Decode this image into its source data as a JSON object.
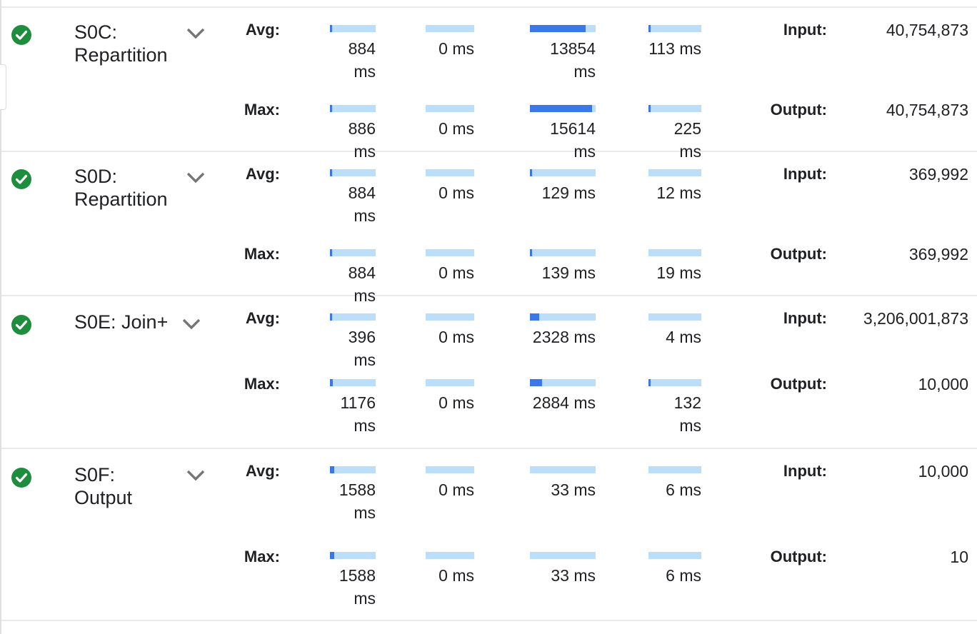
{
  "labels": {
    "avg": "Avg:",
    "max": "Max:",
    "input": "Input:",
    "output": "Output:"
  },
  "colors": {
    "success": "#1e8e3e",
    "bar_track": "#bbdefb",
    "bar_fill": "#3b78e7",
    "chevron": "#757575"
  },
  "icons": {
    "status": "check-circle-icon",
    "expand": "chevron-down-icon"
  },
  "stages": [
    {
      "name": "S0C:\nRepartition",
      "status": "succeeded",
      "avg": [
        {
          "label": "884 ms",
          "fraction": 0.05
        },
        {
          "label": "0 ms",
          "fraction": 0
        },
        {
          "label": "13854 ms",
          "fraction": 0.85
        },
        {
          "label": "113 ms",
          "fraction": 0.01
        }
      ],
      "max": [
        {
          "label": "886 ms",
          "fraction": 0.05
        },
        {
          "label": "0 ms",
          "fraction": 0
        },
        {
          "label": "15614 ms",
          "fraction": 0.95
        },
        {
          "label": "225 ms",
          "fraction": 0.015
        }
      ],
      "input": "40,754,873",
      "output": "40,754,873"
    },
    {
      "name": "S0D:\nRepartition",
      "status": "succeeded",
      "avg": [
        {
          "label": "884 ms",
          "fraction": 0.05
        },
        {
          "label": "0 ms",
          "fraction": 0
        },
        {
          "label": "129 ms",
          "fraction": 0.01
        },
        {
          "label": "12 ms",
          "fraction": 0
        }
      ],
      "max": [
        {
          "label": "884 ms",
          "fraction": 0.05
        },
        {
          "label": "0 ms",
          "fraction": 0
        },
        {
          "label": "139 ms",
          "fraction": 0.01
        },
        {
          "label": "19 ms",
          "fraction": 0
        }
      ],
      "input": "369,992",
      "output": "369,992"
    },
    {
      "name": "S0E: Join+",
      "status": "succeeded",
      "avg": [
        {
          "label": "396 ms",
          "fraction": 0.02
        },
        {
          "label": "0 ms",
          "fraction": 0
        },
        {
          "label": "2328 ms",
          "fraction": 0.14
        },
        {
          "label": "4 ms",
          "fraction": 0
        }
      ],
      "max": [
        {
          "label": "1176 ms",
          "fraction": 0.07
        },
        {
          "label": "0 ms",
          "fraction": 0
        },
        {
          "label": "2884 ms",
          "fraction": 0.18
        },
        {
          "label": "132 ms",
          "fraction": 0.01
        }
      ],
      "input": "3,206,001,873",
      "output": "10,000"
    },
    {
      "name": "S0F:\nOutput",
      "status": "succeeded",
      "avg": [
        {
          "label": "1588 ms",
          "fraction": 0.1
        },
        {
          "label": "0 ms",
          "fraction": 0
        },
        {
          "label": "33 ms",
          "fraction": 0
        },
        {
          "label": "6 ms",
          "fraction": 0
        }
      ],
      "max": [
        {
          "label": "1588 ms",
          "fraction": 0.1
        },
        {
          "label": "0 ms",
          "fraction": 0
        },
        {
          "label": "33 ms",
          "fraction": 0
        },
        {
          "label": "6 ms",
          "fraction": 0
        }
      ],
      "input": "10,000",
      "output": "10"
    }
  ]
}
